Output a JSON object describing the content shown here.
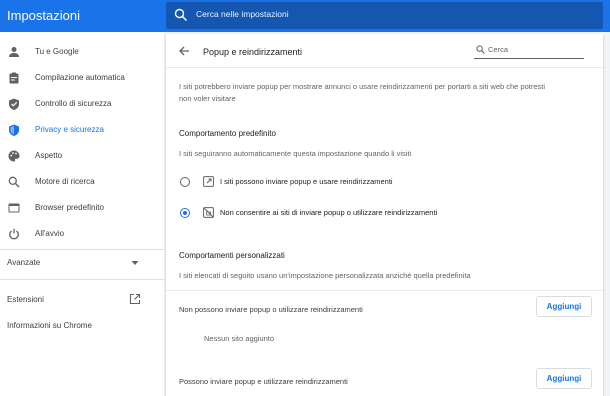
{
  "app": {
    "title": "Impostazioni"
  },
  "search": {
    "placeholder": "Cerca nelle impostazioni"
  },
  "sidebar": {
    "items": [
      {
        "label": "Tu e Google",
        "icon": "person-icon"
      },
      {
        "label": "Compilazione automatica",
        "icon": "clipboard-icon"
      },
      {
        "label": "Controllo di sicurezza",
        "icon": "shield-check-icon"
      },
      {
        "label": "Privacy e sicurezza",
        "icon": "shield-icon",
        "active": true
      },
      {
        "label": "Aspetto",
        "icon": "palette-icon"
      },
      {
        "label": "Motore di ricerca",
        "icon": "search-icon"
      },
      {
        "label": "Browser predefinito",
        "icon": "browser-icon"
      },
      {
        "label": "All'avvio",
        "icon": "power-icon"
      }
    ],
    "advanced_label": "Avanzate",
    "extensions_label": "Estensioni",
    "about_label": "Informazioni su Chrome"
  },
  "main": {
    "title": "Popup e reindirizzamenti",
    "search_placeholder": "Cerca",
    "description_line1": "I siti potrebbero inviare popup per mostrare annunci o usare reindirizzamenti per portarti a siti web che potresti",
    "description_line2": "non voler visitare",
    "default_heading": "Comportamento predefinito",
    "default_subtext": "I siti seguiranno automaticamente questa impostazione quando li visiti",
    "options": [
      {
        "label": "I siti possono inviare popup e usare reindirizzamenti",
        "icon": "open-in-new-icon",
        "checked": false
      },
      {
        "label": "Non consentire ai siti di inviare popup o utilizzare reindirizzamenti",
        "icon": "popup-blocked-icon",
        "checked": true
      }
    ],
    "custom_heading": "Comportamenti personalizzati",
    "custom_subtext": "I siti elencati di seguito usano un'impostazione personalizzata anziché quella predefinita",
    "block_label": "Non possono inviare popup o utilizzare reindirizzamenti",
    "add_button": "Aggiungi",
    "empty_label": "Nessun sito aggiunto",
    "allow_label": "Possono inviare popup e utilizzare reindirizzamenti",
    "add_button_2": "Aggiungi"
  },
  "colors": {
    "accent": "#1a73e8",
    "topbar": "#1a73e8",
    "search_bg": "#1557b0"
  }
}
